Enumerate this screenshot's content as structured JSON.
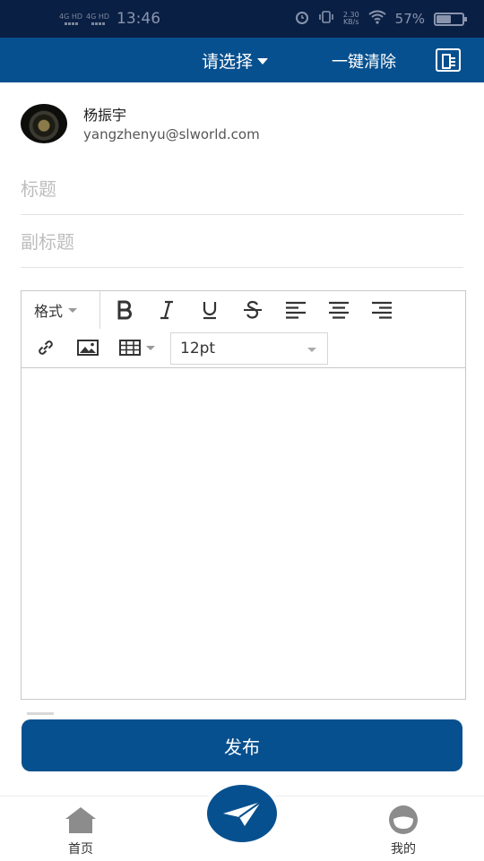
{
  "status_bar": {
    "network_1": "4G HD",
    "network_2": "4G HD",
    "time": "13:46",
    "speed_value": "2.30",
    "speed_unit": "KB/s",
    "battery": "57%",
    "battery_level": 0.57
  },
  "header": {
    "select_label": "请选择",
    "clear_label": "一键清除",
    "doc_icon": "document-icon"
  },
  "user": {
    "name": "杨振宇",
    "email": "yangzhenyu@slworld.com"
  },
  "form": {
    "title_placeholder": "标题",
    "subtitle_placeholder": "副标题"
  },
  "editor": {
    "format_label": "格式",
    "font_size": "12pt",
    "tools": [
      "bold-icon",
      "italic-icon",
      "underline-icon",
      "strikethrough-icon",
      "align-left-icon",
      "align-center-icon",
      "align-right-icon",
      "link-icon",
      "image-icon",
      "table-icon"
    ]
  },
  "actions": {
    "publish_label": "发布"
  },
  "bottom_nav": {
    "home_label": "首页",
    "mine_label": "我的"
  },
  "colors": {
    "primary": "#07508f",
    "status_bar": "#0a1f44"
  }
}
